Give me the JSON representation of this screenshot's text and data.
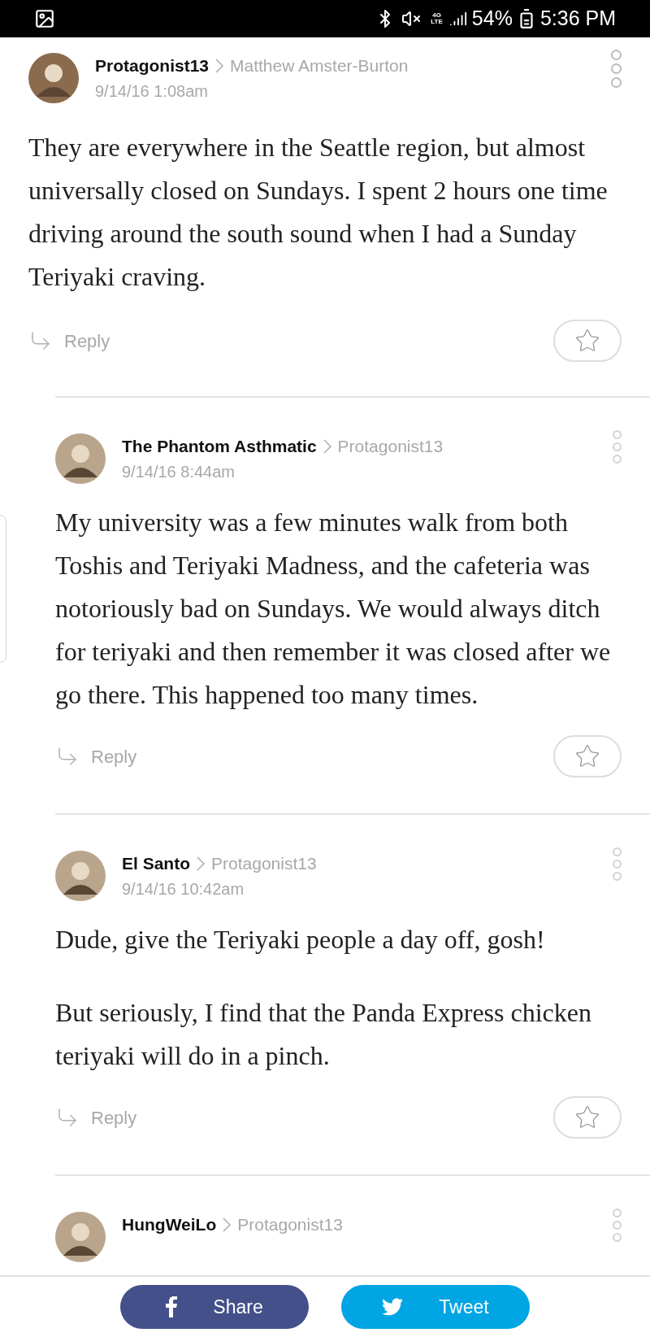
{
  "status_bar": {
    "network": [
      "4G",
      "LTE"
    ],
    "battery": "54%",
    "time": "5:36 PM"
  },
  "comments": [
    {
      "author": "Protagonist13",
      "reply_to": "Matthew Amster-Burton",
      "date": "9/14/16 1:08am",
      "body": [
        "They are everywhere in the Seattle region, but almost universally closed on Sundays. I spent 2 hours one time driving around the south sound when I had a Sunday Teriyaki craving."
      ],
      "reply_label": "Reply",
      "children": [
        {
          "author": "The Phantom Asthmatic",
          "reply_to": "Protagonist13",
          "date": "9/14/16 8:44am",
          "body": [
            "My university was a few minutes walk from both Toshis and Teriyaki Madness, and the cafeteria was notoriously bad on Sundays. We would always ditch for teriyaki and then remember it was closed after we go there. This happened too many times."
          ],
          "reply_label": "Reply"
        },
        {
          "author": "El Santo",
          "reply_to": "Protagonist13",
          "date": "9/14/16 10:42am",
          "body": [
            "Dude, give the Teriyaki people a day off, gosh!",
            "But seriously, I find that the Panda Express chicken teriyaki will do in a pinch."
          ],
          "reply_label": "Reply"
        },
        {
          "author": "HungWeiLo",
          "reply_to": "Protagonist13"
        }
      ]
    }
  ],
  "share_buttons": [
    {
      "kind": "facebook",
      "label": "Share"
    },
    {
      "kind": "twitter",
      "label": "Tweet"
    }
  ]
}
